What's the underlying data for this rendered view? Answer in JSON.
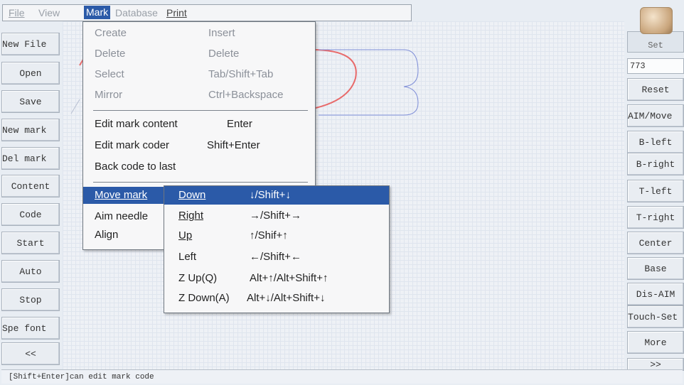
{
  "menubar": {
    "file": "File",
    "view": "View",
    "mark": "Mark",
    "database": "Database",
    "print": "Print"
  },
  "left_buttons": [
    "New File",
    "Open",
    "Save",
    "New mark",
    "Del mark",
    "Content",
    "Code",
    "Start",
    "Auto",
    "Stop",
    "Spe font",
    "<<"
  ],
  "right_panel": {
    "set": "Set",
    "coord_value": "773",
    "buttons": [
      "Reset",
      "AIM/Move",
      "B-left",
      "B-right",
      "T-left",
      "T-right",
      "Center",
      "Base",
      "Dis-AIM",
      "Touch-Set",
      "More",
      ">>"
    ]
  },
  "mark_menu": {
    "items": [
      {
        "label": "Create",
        "shortcut": "Insert"
      },
      {
        "label": "Delete",
        "shortcut": "Delete"
      },
      {
        "label": "Select",
        "shortcut": "Tab/Shift+Tab"
      },
      {
        "label": "Mirror",
        "shortcut": "Ctrl+Backspace"
      },
      {
        "label": "Edit mark content",
        "shortcut": "Enter"
      },
      {
        "label": "Edit mark coder",
        "shortcut": "Shift+Enter"
      },
      {
        "label": "Back code to last",
        "shortcut": ""
      },
      {
        "label": "Move mark",
        "shortcut": ""
      },
      {
        "label": "Aim needle",
        "shortcut": ""
      },
      {
        "label": "Align",
        "shortcut": ""
      }
    ]
  },
  "move_submenu": {
    "items": [
      {
        "label": "Down",
        "shortcut": "↓/Shift+↓"
      },
      {
        "label": "Right",
        "shortcut": "→/Shift+→"
      },
      {
        "label": "Up",
        "shortcut": "↑/Shif+↑"
      },
      {
        "label": "Left",
        "shortcut": "←/Shift+←"
      },
      {
        "label": "Z Up(Q)",
        "shortcut": "Alt+↑/Alt+Shift+↑"
      },
      {
        "label": "Z Down(A)",
        "shortcut": "Alt+↓/Alt+Shift+↓"
      }
    ]
  },
  "status_bar": "[Shift+Enter]can edit mark code",
  "colors": {
    "highlight": "#2b5aa8",
    "mark_red": "#e86a6a",
    "mark_blue": "#7f8ed8"
  }
}
